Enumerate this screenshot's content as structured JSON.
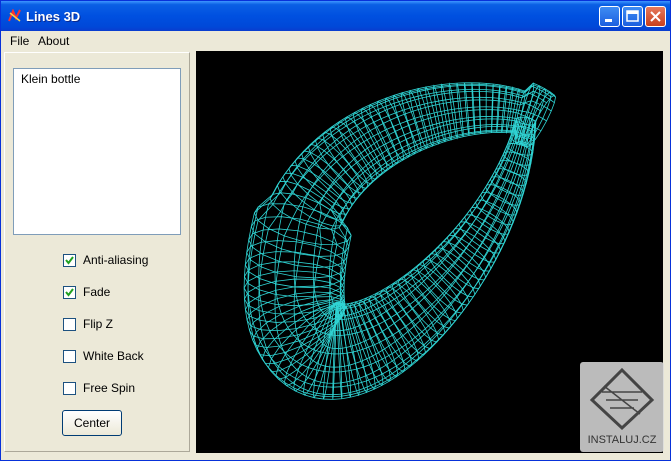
{
  "window": {
    "title": "Lines 3D",
    "title_color": "#ffffff",
    "frame_color": "#0a5fe4"
  },
  "menu": {
    "items": [
      "File",
      "About"
    ]
  },
  "list": {
    "items": [
      "Klein bottle"
    ]
  },
  "options": [
    {
      "label": "Anti-aliasing",
      "checked": true
    },
    {
      "label": "Fade",
      "checked": true
    },
    {
      "label": "Flip Z",
      "checked": false
    },
    {
      "label": "White Back",
      "checked": false
    },
    {
      "label": "Free Spin",
      "checked": false
    }
  ],
  "buttons": {
    "center_label": "Center"
  },
  "viewport": {
    "model": "Klein bottle",
    "background": "#000000",
    "line_color": "#33e0e0"
  },
  "watermark": {
    "text": "INSTALUJ.CZ"
  }
}
